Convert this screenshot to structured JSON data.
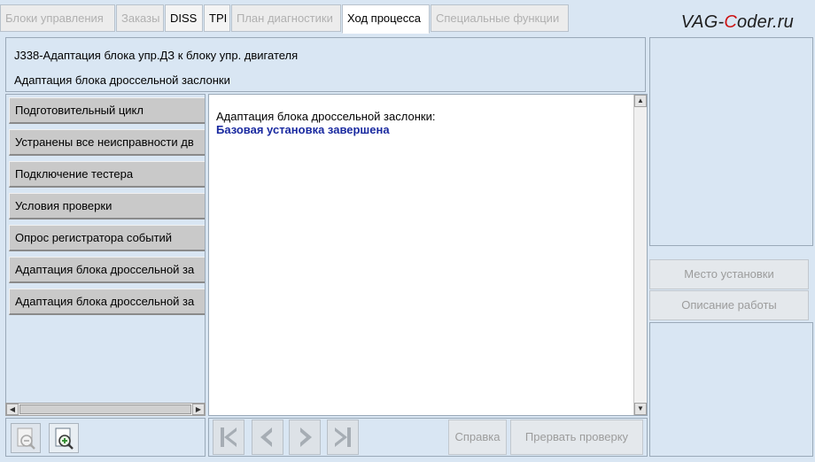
{
  "tabs": [
    {
      "label": "Блоки управления",
      "state": "disabled"
    },
    {
      "label": "Заказы",
      "state": "disabled"
    },
    {
      "label": "DISS",
      "state": "enabled"
    },
    {
      "label": "TPI",
      "state": "enabled"
    },
    {
      "label": "План диагностики",
      "state": "disabled"
    },
    {
      "label": "Ход процесса",
      "state": "active"
    },
    {
      "label": "Специальные функции",
      "state": "disabled"
    }
  ],
  "watermark": {
    "prefix": "VAG-",
    "accent": "C",
    "suffix": "oder.ru"
  },
  "header": {
    "line1": "J338-Адаптация блока упр.ДЗ к блоку упр. двигателя",
    "line2": "Адаптация блока дроссельной заслонки"
  },
  "steps": [
    {
      "label": "Подготовительный цикл"
    },
    {
      "label": "Устранены все неисправности дв"
    },
    {
      "label": "Подключение тестера"
    },
    {
      "label": "Условия проверки"
    },
    {
      "label": "Опрос регистратора событий"
    },
    {
      "label": "Адаптация блока дроссельной за"
    },
    {
      "label": "Адаптация блока дроссельной за"
    }
  ],
  "content": {
    "message": "Адаптация блока дроссельной заслонки:",
    "status": "Базовая установка завершена"
  },
  "right_buttons": {
    "location": "Место установки",
    "description": "Описание работы"
  },
  "bottom_buttons": {
    "help": "Справка",
    "abort": "Прервать проверку"
  },
  "icons": {
    "zoom_out": "zoom-out-icon",
    "zoom_in": "zoom-in-icon",
    "first": "first-page-icon",
    "prev": "previous-icon",
    "next": "next-icon",
    "last": "last-page-icon"
  },
  "colors": {
    "background": "#d9e6f3",
    "status_text": "#1a2aa0",
    "watermark_accent": "#cc1111"
  }
}
